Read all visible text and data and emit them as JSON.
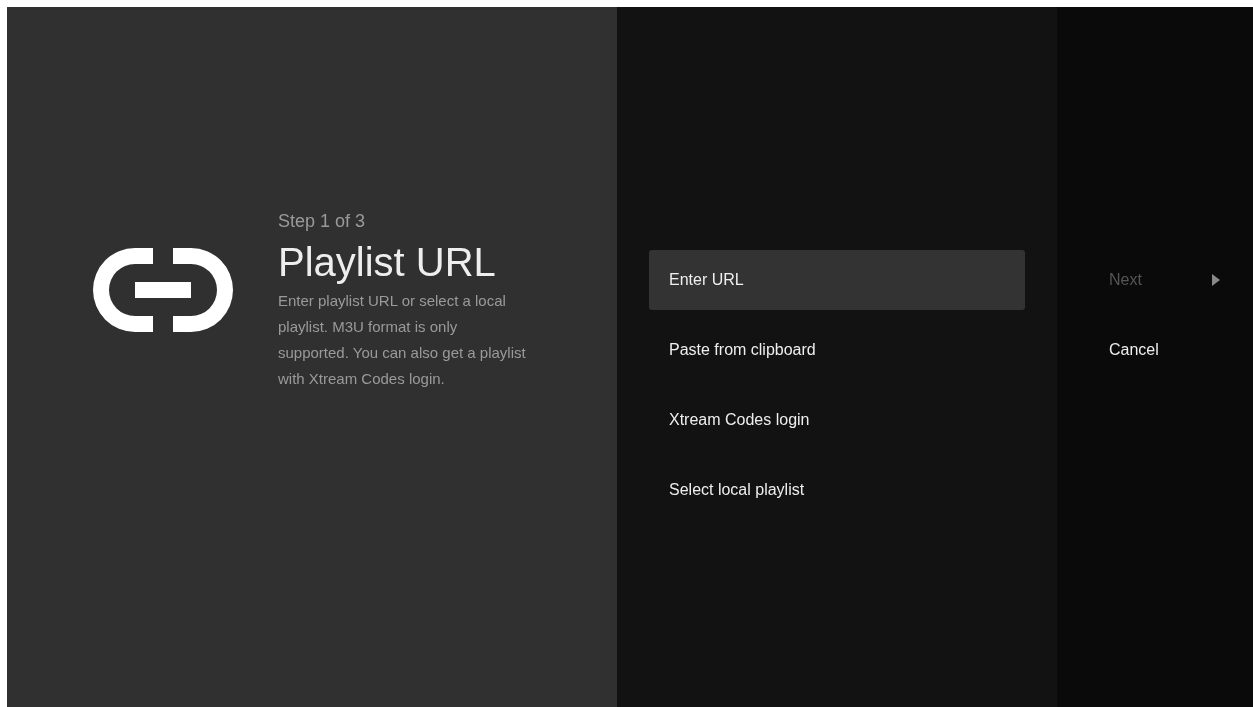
{
  "guidance": {
    "step": "Step 1 of 3",
    "title": "Playlist URL",
    "description": "Enter playlist URL or select a local playlist. M3U format is only supported. You can also get a playlist with Xtream Codes login."
  },
  "actions": [
    {
      "label": "Enter URL",
      "selected": true
    },
    {
      "label": "Paste from clipboard",
      "selected": false
    },
    {
      "label": "Xtream Codes login",
      "selected": false
    },
    {
      "label": "Select local playlist",
      "selected": false
    }
  ],
  "buttons": [
    {
      "label": "Next",
      "disabled": true,
      "kind": "forward"
    },
    {
      "label": "Cancel",
      "disabled": false,
      "kind": "plain"
    }
  ]
}
